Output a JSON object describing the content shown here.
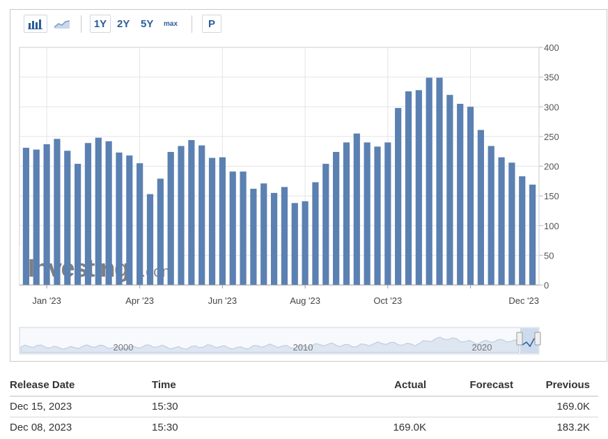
{
  "toolbar": {
    "buttons": [
      "1Y",
      "2Y",
      "5Y",
      "max",
      "P"
    ],
    "icons": [
      "bar-chart-icon",
      "area-chart-icon"
    ]
  },
  "colors": {
    "bar": "#5b80b2",
    "bar_dark": "#4f73a6",
    "accent": "#2a5d98",
    "grid": "#e4e4e4"
  },
  "watermark": {
    "brand": "Investing",
    "suffix": ".com"
  },
  "chart_data": {
    "type": "bar",
    "y_ticks": [
      0,
      50,
      100,
      150,
      200,
      250,
      300,
      350,
      400
    ],
    "ylim": [
      0,
      400
    ],
    "x_tick_labels": [
      "Jan '23",
      "Apr '23",
      "Jun '23",
      "Aug '23",
      "Oct '23",
      "Dec '23"
    ],
    "x_tick_bar_index": [
      2,
      11,
      19,
      27,
      35,
      43
    ],
    "values": [
      231,
      228,
      237,
      246,
      226,
      204,
      239,
      248,
      242,
      223,
      218,
      205,
      153,
      179,
      224,
      234,
      244,
      235,
      214,
      215,
      191,
      191,
      162,
      171,
      155,
      165,
      138,
      141,
      173,
      204,
      224,
      240,
      255,
      240,
      233,
      240,
      298,
      326,
      328,
      349,
      349,
      320,
      305,
      300,
      261,
      234,
      215,
      206,
      183,
      169
    ],
    "navigator_labels": [
      "2000",
      "2010",
      "2020"
    ],
    "grid": true
  },
  "table": {
    "headers": [
      "Release Date",
      "Time",
      "Actual",
      "Forecast",
      "Previous"
    ],
    "rows": [
      {
        "date": "Dec 15, 2023",
        "time": "15:30",
        "actual": "",
        "forecast": "",
        "previous": "169.0K"
      },
      {
        "date": "Dec 08, 2023",
        "time": "15:30",
        "actual": "169.0K",
        "forecast": "",
        "previous": "183.2K"
      }
    ]
  }
}
